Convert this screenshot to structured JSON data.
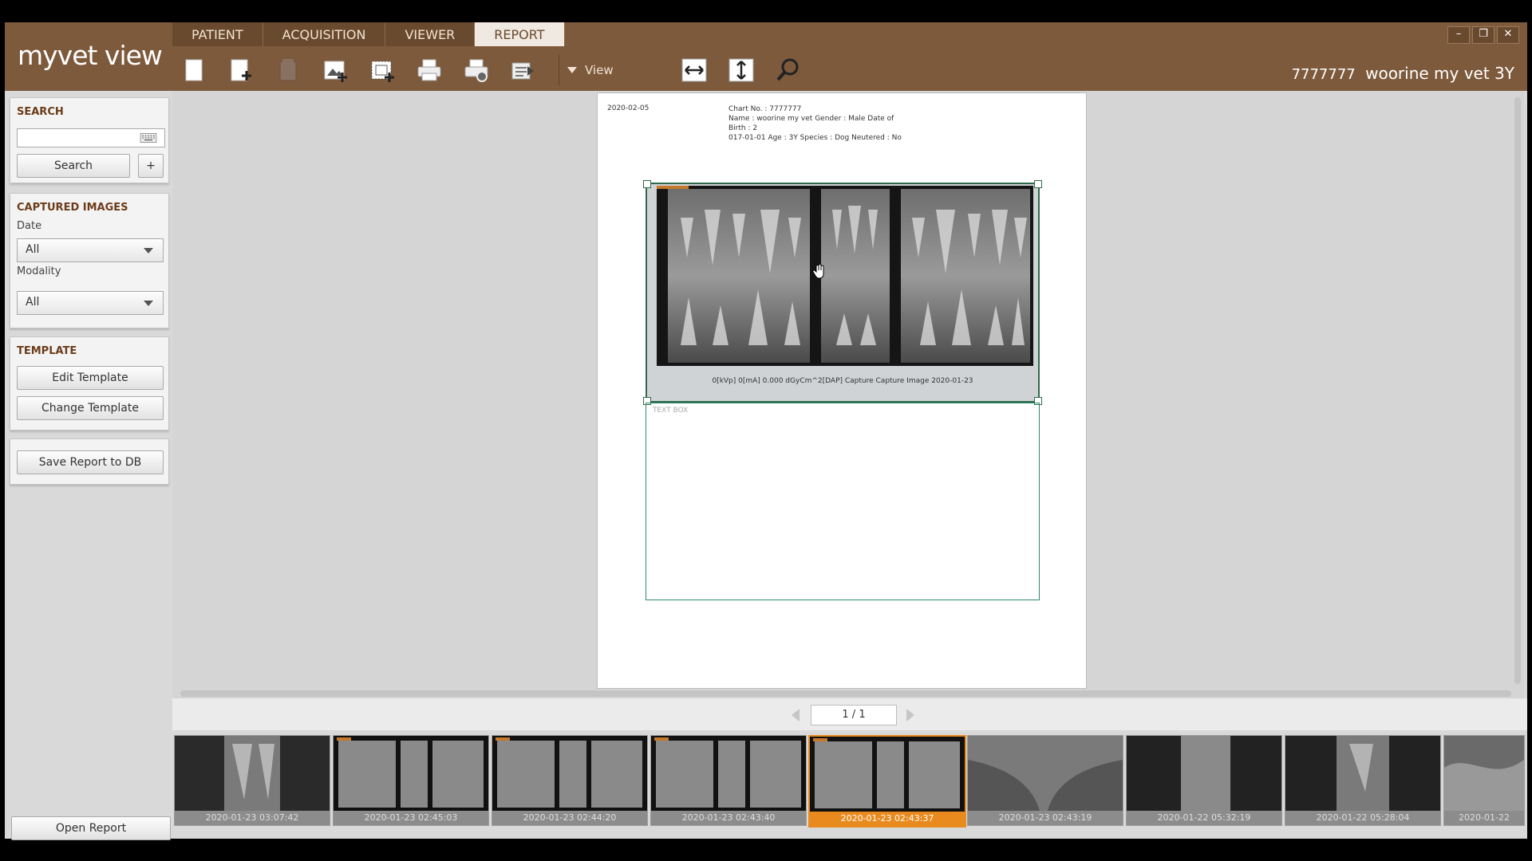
{
  "app": {
    "title": "myvet view"
  },
  "tabs": [
    {
      "label": "PATIENT"
    },
    {
      "label": "ACQUISITION"
    },
    {
      "label": "VIEWER"
    },
    {
      "label": "REPORT"
    }
  ],
  "active_tab": "REPORT",
  "toolbar": {
    "view_label": "View",
    "icons": [
      "new-page-icon",
      "add-page-icon",
      "delete-page-icon",
      "add-image-icon",
      "add-textbox-icon",
      "print-icon",
      "print-settings-icon",
      "export-icon",
      "fit-width-icon",
      "fit-height-icon",
      "zoom-icon"
    ]
  },
  "window_controls": {
    "minimize": "–",
    "restore": "❐",
    "close": "✕"
  },
  "patient": {
    "id": "7777777",
    "name": "woorine my vet 3Y"
  },
  "sidebar": {
    "search": {
      "title": "SEARCH",
      "placeholder": "",
      "search_label": "Search",
      "add_label": "+"
    },
    "captured": {
      "title": "CAPTURED IMAGES",
      "date_label": "Date",
      "date_value": "All",
      "modality_label": "Modality",
      "modality_value": "All"
    },
    "template": {
      "title": "TEMPLATE",
      "edit_label": "Edit Template",
      "change_label": "Change Template"
    },
    "save_label": "Save Report to DB",
    "open_label": "Open Report"
  },
  "report": {
    "date": "2020-02-05",
    "info_line1": "Chart No. : 7777777",
    "info_line2": "Name : woorine my vet Gender : Male Date of Birth : 2",
    "info_line3": "017-01-01 Age : 3Y Species : Dog Neutered : No",
    "image_caption": "0[kVp]   0[mA]   0.000 dGyCm^2[DAP]   Capture   Capture Image   2020-01-23",
    "textbox_label": "TEXT BOX"
  },
  "pager": {
    "label": "1 / 1"
  },
  "thumbnails": [
    {
      "caption": "2020-01-23 03:07:42",
      "selected": false
    },
    {
      "caption": "2020-01-23 02:45:03",
      "selected": false
    },
    {
      "caption": "2020-01-23 02:44:20",
      "selected": false
    },
    {
      "caption": "2020-01-23 02:43:40",
      "selected": false
    },
    {
      "caption": "2020-01-23 02:43:37",
      "selected": true
    },
    {
      "caption": "2020-01-23 02:43:19",
      "selected": false
    },
    {
      "caption": "2020-01-22 05:32:19",
      "selected": false
    },
    {
      "caption": "2020-01-22 05:28:04",
      "selected": false
    },
    {
      "caption": "2020-01-22",
      "selected": false
    }
  ],
  "colors": {
    "brand": "#7d5a3c",
    "accent": "#e98a1e",
    "selection": "#2f6b4a"
  }
}
